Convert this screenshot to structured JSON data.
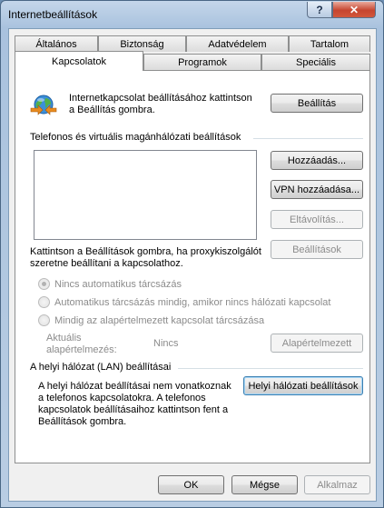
{
  "window": {
    "title": "Internetbeállítások",
    "help_glyph": "?",
    "close_glyph": "✕"
  },
  "tabs_top": [
    "Általános",
    "Biztonság",
    "Adatvédelem",
    "Tartalom"
  ],
  "tabs_bottom": [
    "Kapcsolatok",
    "Programok",
    "Speciális"
  ],
  "active_tab": "Kapcsolatok",
  "setup": {
    "text_line1": "Internetkapcsolat beállításához kattintson",
    "text_line2": "a Beállítás gombra.",
    "button": "Beállítás"
  },
  "vpn_section": {
    "heading": "Telefonos és virtuális magánhálózati beállítások",
    "add_button": "Hozzáadás...",
    "add_vpn_button": "VPN hozzáadása...",
    "remove_button": "Eltávolítás...",
    "proxy_text_line1": "Kattintson a Beállítások gombra, ha proxykiszolgálót",
    "proxy_text_line2": "szeretne beállítani a kapcsolathoz.",
    "settings_button": "Beállítások"
  },
  "dial_options": [
    {
      "label": "Nincs automatikus tárcsázás",
      "checked": true
    },
    {
      "label": "Automatikus tárcsázás mindig, amikor nincs hálózati kapcsolat",
      "checked": false
    },
    {
      "label": "Mindig az alapértelmezett kapcsolat tárcsázása",
      "checked": false
    }
  ],
  "current_default": {
    "label_line1": "Aktuális",
    "label_line2": "alapértelmezés:",
    "value": "Nincs",
    "button": "Alapértelmezett"
  },
  "lan_section": {
    "heading": "A helyi hálózat (LAN) beállításai",
    "text_lines": [
      "A helyi hálózat beállításai nem vonatkoznak",
      "a telefonos kapcsolatokra. A telefonos",
      "kapcsolatok beállításaihoz kattintson fent a",
      "Beállítások gombra."
    ],
    "button": "Helyi hálózati beállítások"
  },
  "footer": {
    "ok": "OK",
    "cancel": "Mégse",
    "apply": "Alkalmaz"
  }
}
